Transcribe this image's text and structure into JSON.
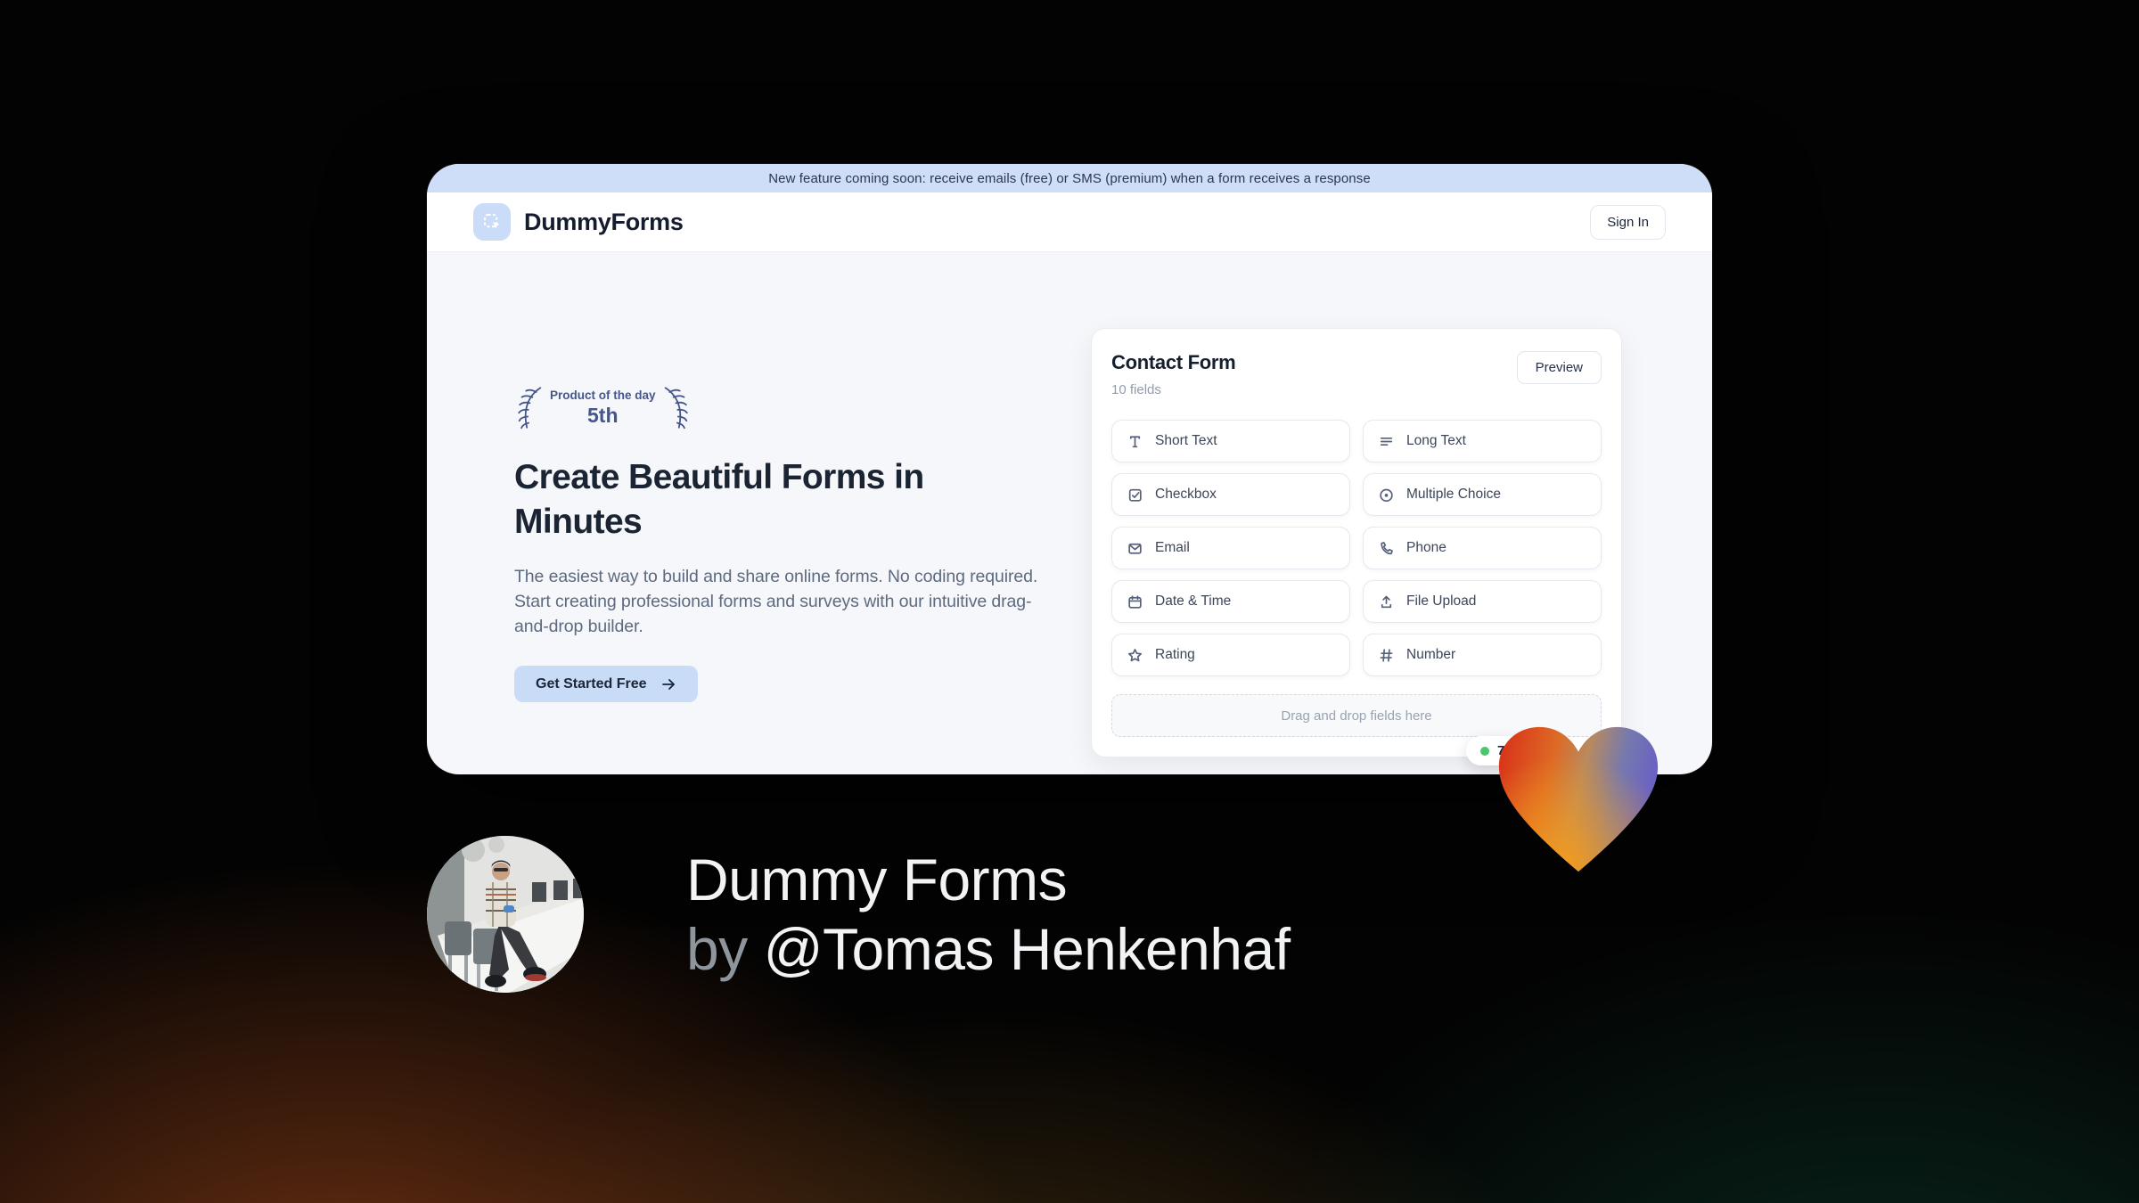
{
  "window": {
    "banner_text": "New feature coming soon: receive emails (free) or SMS (premium) when a form receives a response",
    "brand": "DummyForms",
    "sign_in_label": "Sign In",
    "hero": {
      "badge_line1": "Product of the day",
      "badge_rank": "5th",
      "title": "Create Beautiful Forms in Minutes",
      "description": "The easiest way to build and share online forms. No coding required. Start creating professional forms and surveys with our intuitive drag-and-drop builder.",
      "cta_label": "Get Started Free"
    },
    "form_builder": {
      "title": "Contact Form",
      "field_count": "10 fields",
      "preview_label": "Preview",
      "dropzone_label": "Drag and drop fields here",
      "vote_count": "77",
      "fields": [
        {
          "label": "Short Text",
          "icon": "short-text-icon"
        },
        {
          "label": "Long Text",
          "icon": "long-text-icon"
        },
        {
          "label": "Checkbox",
          "icon": "checkbox-icon"
        },
        {
          "label": "Multiple Choice",
          "icon": "multiple-choice-icon"
        },
        {
          "label": "Email",
          "icon": "email-icon"
        },
        {
          "label": "Phone",
          "icon": "phone-icon"
        },
        {
          "label": "Date & Time",
          "icon": "calendar-icon"
        },
        {
          "label": "File Upload",
          "icon": "upload-icon"
        },
        {
          "label": "Rating",
          "icon": "star-icon"
        },
        {
          "label": "Number",
          "icon": "hash-icon"
        }
      ]
    }
  },
  "caption": {
    "title": "Dummy Forms",
    "byline_prefix": "by",
    "byline_name": "@Tomas Henkenhaf"
  },
  "colors": {
    "banner_bg": "#cfdef8",
    "accent_blue": "#c8dbf7",
    "brand_navy": "#1b2433",
    "laurel_blue": "#44568c",
    "status_green": "#4cc56d",
    "heart_red": "#d93018",
    "heart_orange": "#f49c1c",
    "heart_indigo": "#6a60c4"
  }
}
